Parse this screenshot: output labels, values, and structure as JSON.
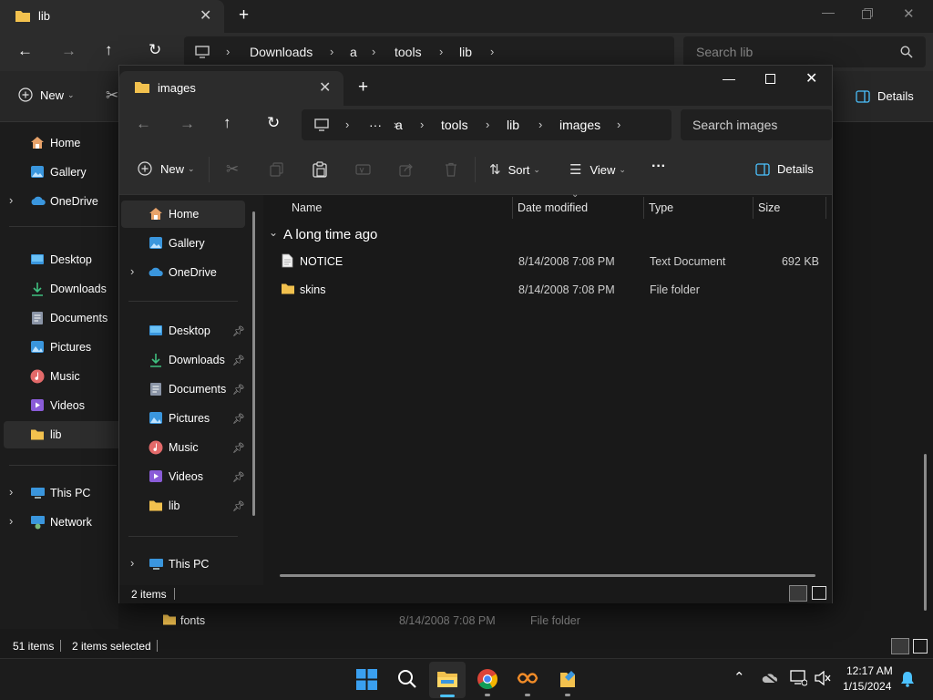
{
  "back_window": {
    "tab_title": "lib",
    "breadcrumb": [
      "Downloads",
      "a",
      "tools",
      "lib"
    ],
    "search_placeholder": "Search lib",
    "new_label": "New",
    "details_label": "Details",
    "sidebar": {
      "top": [
        "Home",
        "Gallery",
        "OneDrive"
      ],
      "libs": [
        "Desktop",
        "Downloads",
        "Documents",
        "Pictures",
        "Music",
        "Videos",
        "lib"
      ],
      "bottom": [
        "This PC",
        "Network"
      ]
    },
    "visible_row": {
      "name": "fonts",
      "date": "8/14/2008 7:08 PM",
      "type": "File folder"
    },
    "status_count": "51 items",
    "status_selected": "2 items selected"
  },
  "front_window": {
    "tab_title": "images",
    "breadcrumb": [
      "···",
      "a",
      "tools",
      "lib",
      "images"
    ],
    "search_placeholder": "Search images",
    "toolbar": {
      "new_label": "New",
      "sort_label": "Sort",
      "view_label": "View",
      "more_label": "···",
      "details_label": "Details"
    },
    "sidebar": {
      "top": [
        "Home",
        "Gallery",
        "OneDrive"
      ],
      "libs": [
        "Desktop",
        "Downloads",
        "Documents",
        "Pictures",
        "Music",
        "Videos",
        "lib"
      ],
      "bottom": [
        "This PC"
      ]
    },
    "columns": [
      "Name",
      "Date modified",
      "Type",
      "Size"
    ],
    "group_label": "A long time ago",
    "files": [
      {
        "name": "NOTICE",
        "date": "8/14/2008 7:08 PM",
        "type": "Text Document",
        "size": "692 KB",
        "icon": "document-icon"
      },
      {
        "name": "skins",
        "date": "8/14/2008 7:08 PM",
        "type": "File folder",
        "size": "",
        "icon": "folder-icon"
      }
    ],
    "status_count": "2 items"
  },
  "taskbar": {
    "time": "12:17 AM",
    "date": "1/15/2024"
  },
  "colors": {
    "folder": "#f2c14e",
    "accent": "#4cc2ff",
    "onedrive": "#3a96dd"
  }
}
